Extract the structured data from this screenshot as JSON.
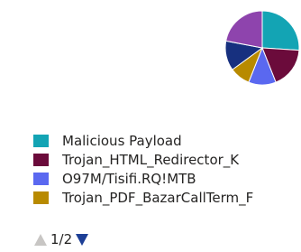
{
  "chart_data": {
    "type": "pie",
    "title": "",
    "slices": [
      {
        "name": "Malicious Payload",
        "value": 26,
        "color": "#13a4b4"
      },
      {
        "name": "Trojan_HTML_Redirector_K",
        "value": 18,
        "color": "#6b0b3b"
      },
      {
        "name": "O97M/Tisifi.RQ!MTB",
        "value": 12,
        "color": "#5a68f0"
      },
      {
        "name": "Trojan_PDF_BazarCallTerm_F",
        "value": 9,
        "color": "#b88a00"
      },
      {
        "name": "",
        "value": 13,
        "color": "#17307f"
      },
      {
        "name": "",
        "value": 22,
        "color": "#8e44ad"
      }
    ],
    "legend": {
      "visible_items": [
        {
          "label": "Malicious Payload",
          "color": "#13a4b4"
        },
        {
          "label": "Trojan_HTML_Redirector_K",
          "color": "#6b0b3b"
        },
        {
          "label": "O97M/Tisifi.RQ!MTB",
          "color": "#5a68f0"
        },
        {
          "label": "Trojan_PDF_BazarCallTerm_F",
          "color": "#b88a00"
        }
      ],
      "placement": "below"
    }
  },
  "pager": {
    "page_text": "1/2",
    "prev_icon": "triangle-up-icon",
    "next_icon": "triangle-down-icon"
  }
}
